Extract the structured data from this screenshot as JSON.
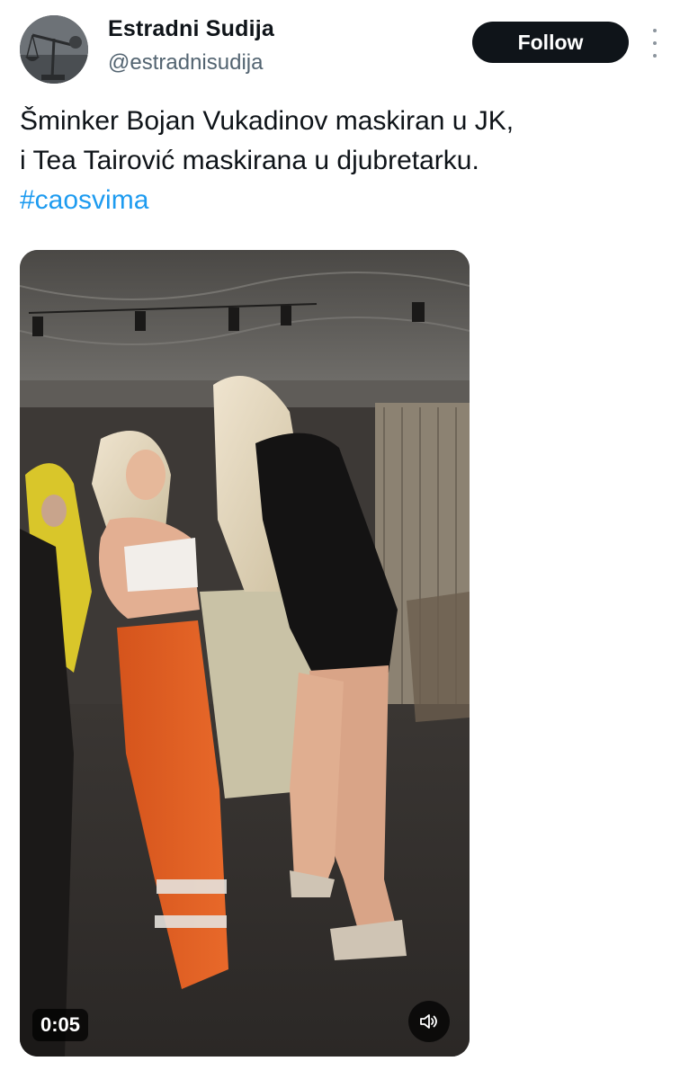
{
  "author": {
    "display_name": "Estradni Sudija",
    "handle": "@estradnisudija",
    "avatar_icon": "scales-of-justice-icon"
  },
  "header": {
    "follow_label": "Follow",
    "more_icon": "more-vertical-icon"
  },
  "tweet": {
    "line1": "Šminker Bojan Vukadinov maskiran u JK,",
    "line2": "i Tea Tairović maskirana u djubretarku.",
    "hashtag": "#caosvima",
    "hashtag_color": "#1d9bf0"
  },
  "media": {
    "type": "video",
    "timestamp": "0:05",
    "volume_icon": "volume-icon"
  },
  "colors": {
    "text": "#0f1419",
    "secondary": "#536471",
    "button": "#0f1419"
  }
}
